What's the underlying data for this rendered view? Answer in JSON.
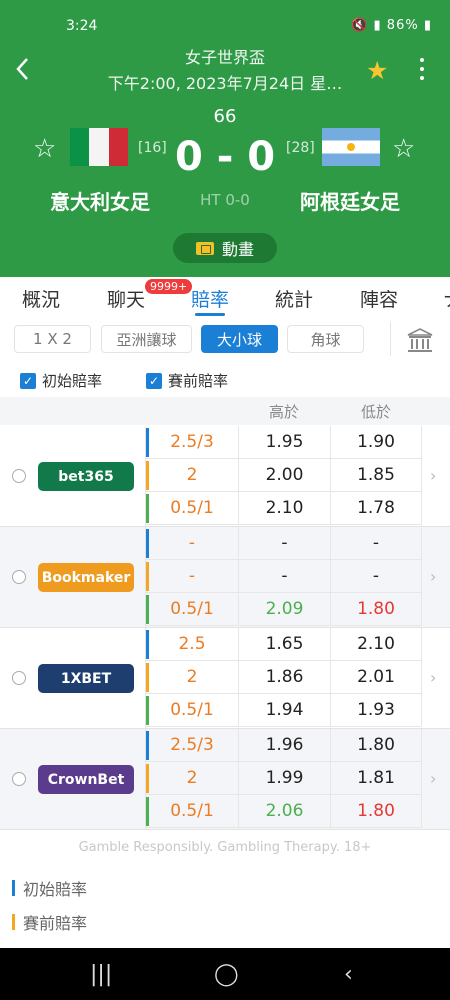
{
  "status_bar": {
    "time": "3:24",
    "battery": "86%"
  },
  "header": {
    "league": "女子世界盃",
    "datetime": "下午2:00, 2023年7月24日 星…",
    "minute": "66",
    "score": "0 - 0",
    "halftime": "HT 0-0",
    "home": {
      "name": "意大利女足",
      "rank": "[16]"
    },
    "away": {
      "name": "阿根廷女足",
      "rank": "[28]"
    },
    "animation_label": "動畫"
  },
  "tabs": [
    {
      "label": "概況"
    },
    {
      "label": "聊天",
      "badge": "9999+"
    },
    {
      "label": "賠率",
      "active": true
    },
    {
      "label": "統計"
    },
    {
      "label": "陣容"
    },
    {
      "label": "ナ"
    }
  ],
  "filters": [
    "1 X 2",
    "亞洲讓球",
    "大小球",
    "角球"
  ],
  "active_filter": "大小球",
  "checkboxes": [
    "初始賠率",
    "賽前賠率"
  ],
  "table_header": {
    "over": "高於",
    "under": "低於"
  },
  "bookmakers": [
    {
      "name": "bet365",
      "color": "#127a4a",
      "rows": [
        {
          "line": "2.5/3",
          "over": "1.95",
          "under": "1.90"
        },
        {
          "line": "2",
          "over": "2.00",
          "under": "1.85"
        },
        {
          "line": "0.5/1",
          "over": "2.10",
          "under": "1.78"
        }
      ]
    },
    {
      "name": "Bookmaker",
      "color": "#ef9b1f",
      "rows": [
        {
          "line": "-",
          "over": "-",
          "under": "-"
        },
        {
          "line": "-",
          "over": "-",
          "under": "-"
        },
        {
          "line": "0.5/1",
          "over": "2.09",
          "under": "1.80",
          "over_trend": "up",
          "under_trend": "down"
        }
      ]
    },
    {
      "name": "1XBET",
      "color": "#1d3e6e",
      "rows": [
        {
          "line": "2.5",
          "over": "1.65",
          "under": "2.10"
        },
        {
          "line": "2",
          "over": "1.86",
          "under": "2.01"
        },
        {
          "line": "0.5/1",
          "over": "1.94",
          "under": "1.93"
        }
      ]
    },
    {
      "name": "CrownBet",
      "color": "#5a3b8c",
      "rows": [
        {
          "line": "2.5/3",
          "over": "1.96",
          "under": "1.80"
        },
        {
          "line": "2",
          "over": "1.99",
          "under": "1.81"
        },
        {
          "line": "0.5/1",
          "over": "2.06",
          "under": "1.80",
          "over_trend": "up",
          "under_trend": "down"
        }
      ]
    }
  ],
  "disclaimer": "Gamble Responsibly. Gambling Therapy. 18+",
  "legend": [
    {
      "label": "初始賠率",
      "color": "#1c7fd6"
    },
    {
      "label": "賽前賠率",
      "color": "#f5a623"
    }
  ],
  "colors": {
    "header_bg": "#2f9a46",
    "accent": "#1c7fd6",
    "line_text": "#ec7c22",
    "bar_blue": "#1c7fd6",
    "bar_orange": "#f5a623",
    "bar_green": "#4caf50"
  }
}
